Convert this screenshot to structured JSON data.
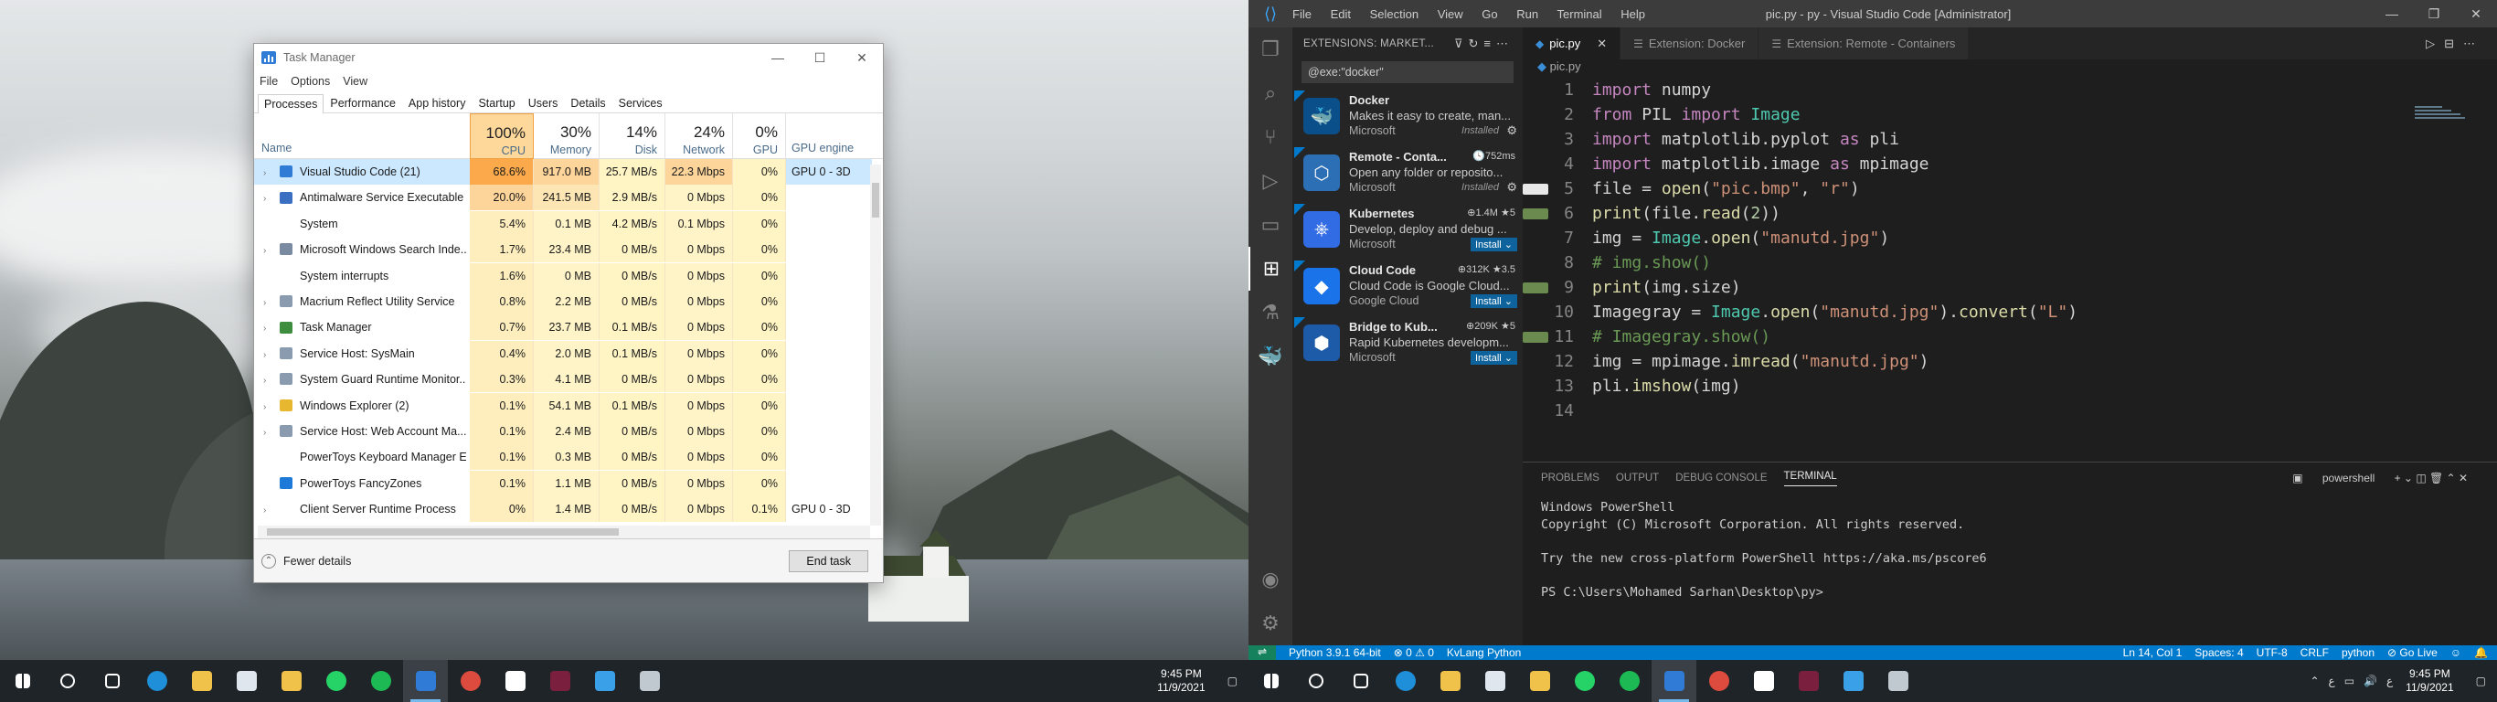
{
  "taskmanager": {
    "title": "Task Manager",
    "menu": [
      "File",
      "Options",
      "View"
    ],
    "tabs": [
      "Processes",
      "Performance",
      "App history",
      "Startup",
      "Users",
      "Details",
      "Services"
    ],
    "active_tab": "Processes",
    "columns": {
      "name": "Name",
      "cpu": {
        "pct": "100%",
        "label": "CPU"
      },
      "memory": {
        "pct": "30%",
        "label": "Memory"
      },
      "disk": {
        "pct": "14%",
        "label": "Disk"
      },
      "network": {
        "pct": "24%",
        "label": "Network"
      },
      "gpu": {
        "pct": "0%",
        "label": "GPU"
      },
      "gpu_engine": "GPU engine"
    },
    "rows": [
      {
        "name": "Visual Studio Code (21)",
        "cpu": "68.6%",
        "mem": "917.0 MB",
        "disk": "25.7 MB/s",
        "net": "22.3 Mbps",
        "gpu": "0%",
        "eng": "GPU 0 - 3D",
        "icon": "vscode-icon",
        "color": "#2f7bd5",
        "exp": "›"
      },
      {
        "name": "Antimalware Service Executable",
        "cpu": "20.0%",
        "mem": "241.5 MB",
        "disk": "2.9 MB/s",
        "net": "0 Mbps",
        "gpu": "0%",
        "eng": "",
        "icon": "shield-icon",
        "color": "#3a6fc2",
        "exp": "›"
      },
      {
        "name": "System",
        "cpu": "5.4%",
        "mem": "0.1 MB",
        "disk": "4.2 MB/s",
        "net": "0.1 Mbps",
        "gpu": "0%",
        "eng": "",
        "icon": "",
        "color": "",
        "exp": ""
      },
      {
        "name": "Microsoft Windows Search Inde...",
        "cpu": "1.7%",
        "mem": "23.4 MB",
        "disk": "0 MB/s",
        "net": "0 Mbps",
        "gpu": "0%",
        "eng": "",
        "icon": "search-index-icon",
        "color": "#7a8aa0",
        "exp": "›"
      },
      {
        "name": "System interrupts",
        "cpu": "1.6%",
        "mem": "0 MB",
        "disk": "0 MB/s",
        "net": "0 Mbps",
        "gpu": "0%",
        "eng": "",
        "icon": "",
        "color": "",
        "exp": ""
      },
      {
        "name": "Macrium Reflect Utility Service",
        "cpu": "0.8%",
        "mem": "2.2 MB",
        "disk": "0 MB/s",
        "net": "0 Mbps",
        "gpu": "0%",
        "eng": "",
        "icon": "service-icon",
        "color": "#8a9bb0",
        "exp": "›"
      },
      {
        "name": "Task Manager",
        "cpu": "0.7%",
        "mem": "23.7 MB",
        "disk": "0.1 MB/s",
        "net": "0 Mbps",
        "gpu": "0%",
        "eng": "",
        "icon": "taskmanager-icon",
        "color": "#3e8d3e",
        "exp": "›"
      },
      {
        "name": "Service Host: SysMain",
        "cpu": "0.4%",
        "mem": "2.0 MB",
        "disk": "0.1 MB/s",
        "net": "0 Mbps",
        "gpu": "0%",
        "eng": "",
        "icon": "service-icon",
        "color": "#8a9bb0",
        "exp": "›"
      },
      {
        "name": "System Guard Runtime Monitor...",
        "cpu": "0.3%",
        "mem": "4.1 MB",
        "disk": "0 MB/s",
        "net": "0 Mbps",
        "gpu": "0%",
        "eng": "",
        "icon": "service-icon",
        "color": "#8a9bb0",
        "exp": "›"
      },
      {
        "name": "Windows Explorer (2)",
        "cpu": "0.1%",
        "mem": "54.1 MB",
        "disk": "0.1 MB/s",
        "net": "0 Mbps",
        "gpu": "0%",
        "eng": "",
        "icon": "folder-icon",
        "color": "#e8b730",
        "exp": "›"
      },
      {
        "name": "Service Host: Web Account Ma...",
        "cpu": "0.1%",
        "mem": "2.4 MB",
        "disk": "0 MB/s",
        "net": "0 Mbps",
        "gpu": "0%",
        "eng": "",
        "icon": "service-icon",
        "color": "#8a9bb0",
        "exp": "›"
      },
      {
        "name": "PowerToys Keyboard Manager E...",
        "cpu": "0.1%",
        "mem": "0.3 MB",
        "disk": "0 MB/s",
        "net": "0 Mbps",
        "gpu": "0%",
        "eng": "",
        "icon": "",
        "color": "",
        "exp": ""
      },
      {
        "name": "PowerToys FancyZones",
        "cpu": "0.1%",
        "mem": "1.1 MB",
        "disk": "0 MB/s",
        "net": "0 Mbps",
        "gpu": "0%",
        "eng": "",
        "icon": "fancyzones-icon",
        "color": "#1e7ad8",
        "exp": ""
      },
      {
        "name": "Client Server Runtime Process",
        "cpu": "0%",
        "mem": "1.4 MB",
        "disk": "0 MB/s",
        "net": "0 Mbps",
        "gpu": "0.1%",
        "eng": "GPU 0 - 3D",
        "icon": "",
        "color": "",
        "exp": "›"
      }
    ],
    "fewer_details": "Fewer details",
    "end_task": "End task"
  },
  "vscode": {
    "window_title": "pic.py - py - Visual Studio Code [Administrator]",
    "menu": [
      "File",
      "Edit",
      "Selection",
      "View",
      "Go",
      "Run",
      "Terminal",
      "Help"
    ],
    "sidebar_title": "EXTENSIONS: MARKET...",
    "search_value": "@exe:\"docker\"",
    "extensions": [
      {
        "name": "Docker",
        "desc": "Makes it easy to create, man...",
        "publisher": "Microsoft",
        "meta": "",
        "state": "Installed",
        "action": "",
        "icon_color": "#0b4f8a",
        "glyph": "🐳"
      },
      {
        "name": "Remote - Conta...",
        "desc": "Open any folder or reposito...",
        "publisher": "Microsoft",
        "meta": "🕓752ms",
        "state": "Installed",
        "action": "",
        "icon_color": "#2d6fb5",
        "glyph": "⬡"
      },
      {
        "name": "Kubernetes",
        "desc": "Develop, deploy and debug ...",
        "publisher": "Microsoft",
        "meta": "⊕1.4M ★5",
        "state": "",
        "action": "Install ⌄",
        "icon_color": "#326ce5",
        "glyph": "⎈"
      },
      {
        "name": "Cloud Code",
        "desc": "Cloud Code is Google Cloud...",
        "publisher": "Google Cloud",
        "meta": "⊕312K ★3.5",
        "state": "",
        "action": "Install ⌄",
        "icon_color": "#1a73e8",
        "glyph": "◆"
      },
      {
        "name": "Bridge to Kub...",
        "desc": "Rapid Kubernetes developm...",
        "publisher": "Microsoft",
        "meta": "⊕209K ★5",
        "state": "",
        "action": "Install ⌄",
        "icon_color": "#1d5aa8",
        "glyph": "⬢"
      }
    ],
    "tabs": [
      {
        "label": "pic.py",
        "active": true
      },
      {
        "label": "Extension: Docker",
        "active": false
      },
      {
        "label": "Extension: Remote - Containers",
        "active": false
      }
    ],
    "breadcrumb": "pic.py",
    "code_lines": [
      "import numpy",
      "from PIL import Image",
      "import matplotlib.pyplot as pli",
      "import matplotlib.image as mpimage",
      "file = open(\"pic.bmp\", \"r\")",
      "print(file.read(2))",
      "img = Image.open(\"manutd.jpg\")",
      "# img.show()",
      "print(img.size)",
      "Imagegray = Image.open(\"manutd.jpg\").convert(\"L\")",
      "# Imagegray.show()",
      "img = mpimage.imread(\"manutd.jpg\")",
      "pli.imshow(img)",
      ""
    ],
    "panel_tabs": [
      "PROBLEMS",
      "OUTPUT",
      "DEBUG CONSOLE",
      "TERMINAL"
    ],
    "panel_active": "TERMINAL",
    "terminal_shell": "powershell",
    "terminal_text": "Windows PowerShell\nCopyright (C) Microsoft Corporation. All rights reserved.\n\nTry the new cross-platform PowerShell https://aka.ms/pscore6\n\nPS C:\\Users\\Mohamed Sarhan\\Desktop\\py>",
    "status": {
      "python": "Python 3.9.1 64-bit",
      "problems": "⊗ 0  ⚠ 0",
      "kvlang": "KvLang Python",
      "position": "Ln 14, Col 1",
      "spaces": "Spaces: 4",
      "encoding": "UTF-8",
      "eol": "CRLF",
      "language": "python",
      "golive": "⊘ Go Live"
    }
  },
  "taskbar": {
    "time": "9:45 PM",
    "date": "11/9/2021",
    "left_icons": [
      "windows-start-icon",
      "search-icon",
      "task-view-icon",
      "edge-icon",
      "file-explorer-icon",
      "mail-icon",
      "store-icon",
      "whatsapp-icon",
      "spotify-icon",
      "vscode-icon",
      "chrome-icon",
      "notion-icon",
      "vim-icon",
      "app-blue-icon",
      "taskmanager-icon"
    ],
    "left_colors": [
      "#ffffff",
      "#ffffff",
      "#ffffff",
      "#1e8fd8",
      "#f0c24a",
      "#dfe6ee",
      "#f0c24a",
      "#25d366",
      "#1db954",
      "#2f7bd5",
      "#dd4b3e",
      "#ffffff",
      "#7a1f3d",
      "#3aa0e8",
      "#c0c8d0"
    ],
    "active_index": 9
  }
}
